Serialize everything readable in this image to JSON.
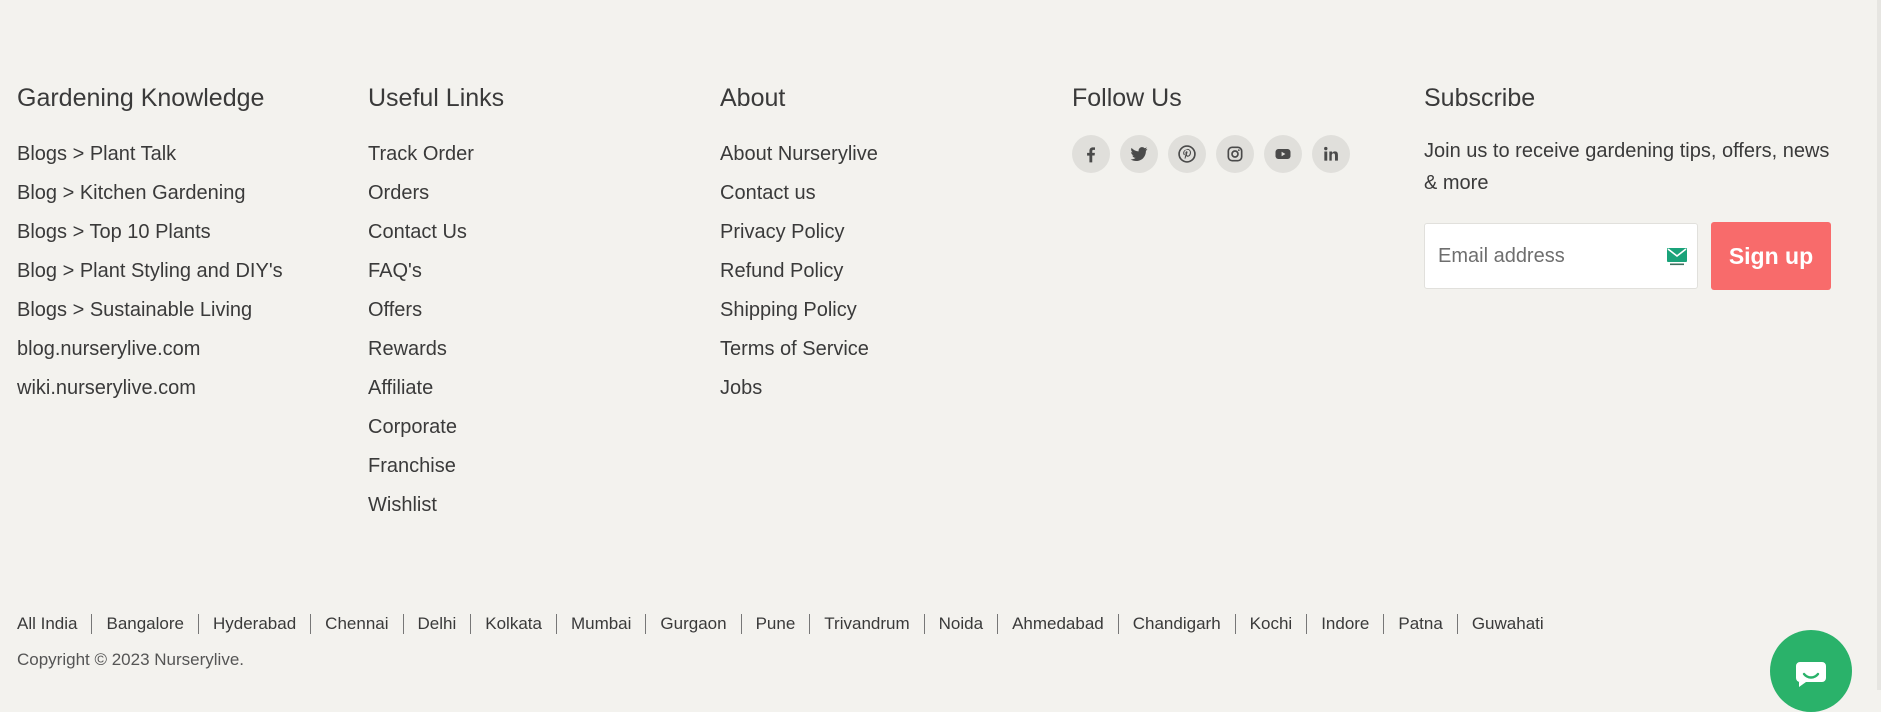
{
  "gardening": {
    "title": "Gardening Knowledge",
    "links": [
      "Blogs > Plant Talk",
      "Blog > Kitchen Gardening",
      "Blogs > Top 10 Plants",
      "Blog > Plant Styling and DIY's",
      "Blogs > Sustainable Living",
      "blog.nurserylive.com",
      "wiki.nurserylive.com"
    ]
  },
  "useful": {
    "title": "Useful Links",
    "links": [
      "Track Order",
      "Orders",
      "Contact Us",
      "FAQ's",
      "Offers",
      "Rewards",
      "Affiliate",
      "Corporate",
      "Franchise",
      "Wishlist"
    ]
  },
  "about": {
    "title": "About",
    "links": [
      "About Nurserylive",
      "Contact us",
      "Privacy Policy",
      "Refund Policy",
      "Shipping Policy",
      "Terms of Service",
      "Jobs"
    ]
  },
  "follow": {
    "title": "Follow Us",
    "icons": [
      "facebook-icon",
      "twitter-icon",
      "pinterest-icon",
      "instagram-icon",
      "youtube-icon",
      "linkedin-icon"
    ]
  },
  "subscribe": {
    "title": "Subscribe",
    "text": "Join us to receive gardening tips, offers, news & more",
    "email_placeholder": "Email address",
    "signup_label": "Sign up",
    "button_color": "#f86b6b"
  },
  "cities": [
    "All India",
    "Bangalore",
    "Hyderabad",
    "Chennai",
    "Delhi",
    "Kolkata",
    "Mumbai",
    "Gurgaon",
    "Pune",
    "Trivandrum",
    "Noida",
    "Ahmedabad",
    "Chandigarh",
    "Kochi",
    "Indore",
    "Patna",
    "Guwahati"
  ],
  "copyright": "Copyright © 2023 Nurserylive.",
  "chat": {
    "icon": "chat-icon",
    "color": "#2ab26a"
  }
}
